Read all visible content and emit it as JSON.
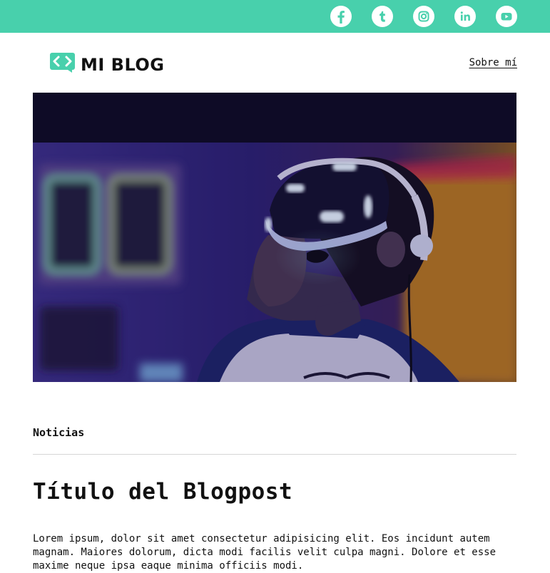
{
  "colors": {
    "brand": "#48d0ac",
    "text": "#111111",
    "divider": "#d6d6d6"
  },
  "topbar": {
    "social_icons": [
      {
        "name": "facebook-icon",
        "glyph": "f"
      },
      {
        "name": "tumblr-icon",
        "glyph": "t"
      },
      {
        "name": "instagram-icon",
        "glyph": "instagram"
      },
      {
        "name": "linkedin-icon",
        "glyph": "in"
      },
      {
        "name": "youtube-icon",
        "glyph": "play"
      }
    ]
  },
  "header": {
    "logo_text": "MI BLOG",
    "logo_icon": "code-chat-bubble-icon",
    "about_link": "Sobre mí"
  },
  "hero": {
    "image": "person-wearing-vr-headset"
  },
  "post": {
    "category": "Noticias",
    "title": "Título del Blogpost",
    "body": "Lorem ipsum, dolor sit amet consectetur adipisicing elit. Eos incidunt autem magnam. Maiores dolorum, dicta modi facilis velit culpa magni. Dolore et esse maxime neque ipsa eaque minima officiis modi."
  }
}
